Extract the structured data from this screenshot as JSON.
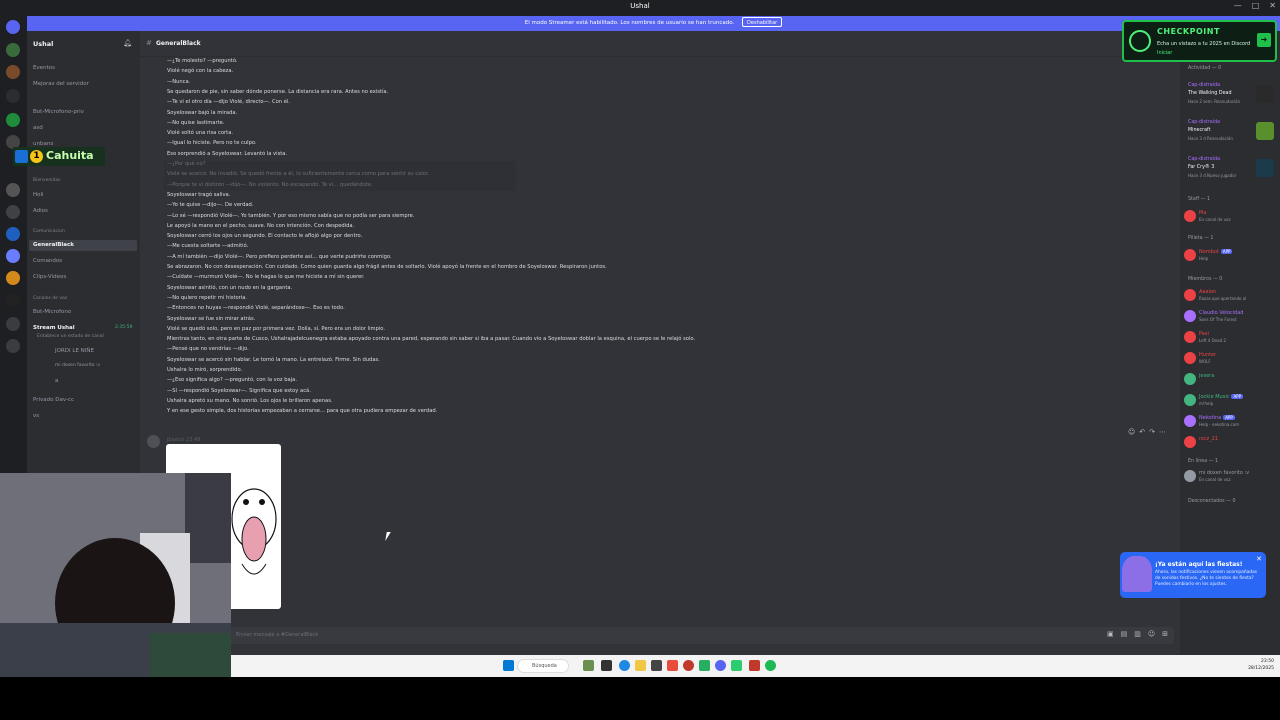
{
  "window": {
    "title": "Ushal"
  },
  "banner": {
    "text": "El modo Streamer está habilitado. Los nombres de usuario se han truncado.",
    "button": "Deshabilitar"
  },
  "server": {
    "name": "Ushal"
  },
  "sidebar": {
    "top_items": [
      "Eventos",
      "Mejoras del servidor"
    ],
    "channels_a": [
      "Bot-Microfono-priv",
      "asd",
      "unbans"
    ],
    "cat_label": "Bienvenidas",
    "channels_b": [
      "Holi",
      "Adios"
    ],
    "cat_comunicacion": "Comunicacion",
    "channels_c": [
      "GeneralBlack",
      "Comandos",
      "Clips-Videos"
    ],
    "cat_voz": "Canales de voz",
    "voice": [
      "Bot-Microfono",
      "Stream Ushal"
    ],
    "stream_time": "2:35:59",
    "stream_status": "Entablece un estado de canal",
    "voice_users": [
      "JORDI LE NIÑE",
      "mi doxen favorito :v",
      "a"
    ],
    "more_channels": [
      "Privado Dav-cc",
      "vs"
    ]
  },
  "chat": {
    "channel": "GeneralBlack",
    "lines": [
      "—¿Te molesto? —preguntó.",
      "Violé negó con la cabeza.",
      "—Nunca.",
      "Se quedaron de pie, sin saber dónde ponerse. La distancia era rara. Antes no existía.",
      "—Te vi el otro día —dijo Violé, directo—. Con él.",
      "Soyeloswar bajó la mirada.",
      "—No quise lastimarte.",
      "Violé soltó una risa corta.",
      "—Igual lo hiciste. Pero no te culpo.",
      "Eso sorprendió a Soyeloswar. Levantó la vista."
    ],
    "dim_lines": [
      "—¿Por qué no?",
      "Violé se acercó. No invadió. Se quedó frente a él, lo suficientemente cerca como para sentir su calor.",
      "—Porque te vi distinto —dijo—. No violento. No escapando. Te vi... quedándote."
    ],
    "lines2": [
      "Soyeloswar tragó saliva.",
      "—Yo te quise —dijo—. De verdad.",
      "—Lo sé —respondió Violé—. Yo también. Y por eso mismo sabía que no podía ser para siempre.",
      "Le apoyó la mano en el pecho, suave. No con intención. Con despedida.",
      "Soyeloswar cerró los ojos un segundo. El contacto le aflojó algo por dentro.",
      "—Me cuesta soltarte —admitió.",
      "—A mí también —dijo Violé—. Pero prefiero perderte así... que verte pudrirte conmigo.",
      "Se abrazaron. No con desesperación. Con cuidado. Como quien guarda algo frágil antes de soltarlo. Violé apoyó la frente en el hombro de Soyeloswar. Respiraron juntos.",
      "—Cuídate —murmuró Violé—. No le hagas lo que me hiciste a mí sin querer.",
      "Soyeloswar asintió, con un nudo en la garganta.",
      "—No quiero repetir mi historia.",
      "—Entonces no huyas —respondió Violé, separándose—. Eso es todo.",
      "Soyeloswar se fue sin mirar atrás.",
      "Violé se quedó solo, pero en paz por primera vez. Dolía, sí. Pero era un dolor limpio.",
      "Mientras tanto, en otra parte de Cusco, Ushalrajadelcuenegra estaba apoyado contra una pared, esperando sin saber si iba a pasar. Cuando vio a Soyeloswar doblar la esquina, el cuerpo se le relajó solo.",
      "—Pensé que no vendrías —dijo.",
      "Soyeloswar se acercó sin hablar. Le tomó la mano. La entrelazó. Firme. Sin dudas.",
      "Ushalra lo miró, sorprendido.",
      "—¿Eso significa algo? —preguntó, con la voz baja.",
      "—Sí —respondió Soyeloswar—. Significa que estoy acá.",
      "Ushalra apretó su mano. No sonrió. Los ojos le brillaron apenas.",
      "Y en ese gesto simple, dos historias empezaban a cerrarse... para que otra pudiera empezar de verdad."
    ],
    "author": "jbasico",
    "time": "23:49",
    "composer_placeholder": "Enviar mensaje a #GeneralBlack"
  },
  "members": {
    "activity_header": "Actividad — 0",
    "activities": [
      {
        "user": "Cap-distraída",
        "game": "The Walking Dead",
        "detail": "Hace 2 sem.  Reanudación",
        "color": "#a970ff",
        "img": "#2a2a2a"
      },
      {
        "user": "Cap-distraída",
        "game": "Minecraft",
        "detail": "Hace 3 d  Reanudación",
        "color": "#a970ff",
        "img": "#5a8f2e"
      },
      {
        "user": "Cap-distraída",
        "game": "Far Cry® 3",
        "detail": "Hace 3 d  Nuevo jugador",
        "color": "#a970ff",
        "img": "#1b3a4b"
      }
    ],
    "staff_header": "Staff — 1",
    "staff": [
      {
        "name": "Ma",
        "status": "En canal de voz",
        "color": "#ed4245"
      }
    ],
    "bot_header": "Pilleta — 1",
    "bots": [
      {
        "name": "Nombot",
        "badge": "APP",
        "status": "Help",
        "color": "#ed4245"
      }
    ],
    "members_header": "Miembros — 0",
    "member_list": [
      {
        "name": "Aaalen",
        "status": "Razas que apertando al",
        "color": "#ed4245"
      },
      {
        "name": "Claudio Velocidad",
        "status": "Sons Of The Forest",
        "color": "#a970ff"
      },
      {
        "name": "Pasi",
        "status": "Left 4 Dead 2",
        "color": "#ed4245"
      },
      {
        "name": "Hunter",
        "status": "WOLF",
        "color": "#ed4245"
      },
      {
        "name": "jesera",
        "status": "",
        "color": "#43b581"
      },
      {
        "name": "Jockie Music",
        "badge": "APP",
        "status": "m!help",
        "color": "#43b581"
      },
      {
        "name": "Nekotina",
        "badge": "APP",
        "status": "Help · nekotina.com",
        "color": "#a970ff"
      },
      {
        "name": "rxcz_21",
        "status": "",
        "color": "#ed4245"
      }
    ],
    "online_header": "En línea — 1",
    "online": [
      {
        "name": "mi doxen favorito :v",
        "status": "En canal de voz",
        "color": "#949ba4"
      }
    ],
    "offline_header": "Desconectados — 0"
  },
  "checkpoint": {
    "title": "CHECKPOINT",
    "text": "Echa un vistazo a tu 2025 en Discord",
    "link": "Iniciar"
  },
  "fiestas": {
    "title": "¡Ya están aquí las fiestas!",
    "text": "Ahora, las notificaciones vienen acompañadas de sonidos festivos. ¿No te sientes de fiesta? Puedes cambiarlo en los ajustes."
  },
  "overlay": {
    "cahuita": "Cahuita",
    "cahuita_num": "1"
  },
  "taskbar": {
    "search": "Búsqueda",
    "time": "23:50",
    "date": "28/12/2025"
  }
}
